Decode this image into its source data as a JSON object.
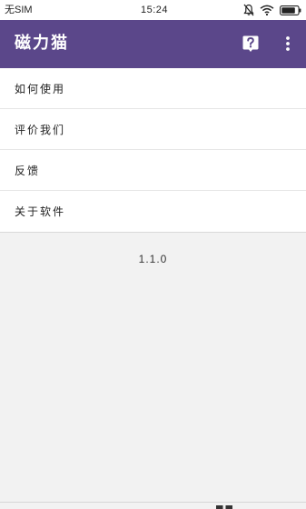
{
  "status_bar": {
    "carrier": "无SIM",
    "time": "15:24",
    "icons": [
      "mute-icon",
      "wifi-icon",
      "battery-icon"
    ]
  },
  "app_bar": {
    "title": "磁力猫",
    "actions": [
      "help-icon",
      "more-vertical-icon"
    ],
    "color": "#5b478a"
  },
  "menu": {
    "items": [
      {
        "label": "如何使用"
      },
      {
        "label": "评价我们"
      },
      {
        "label": "反馈"
      },
      {
        "label": "关于软件"
      }
    ]
  },
  "version": "1.1.0"
}
